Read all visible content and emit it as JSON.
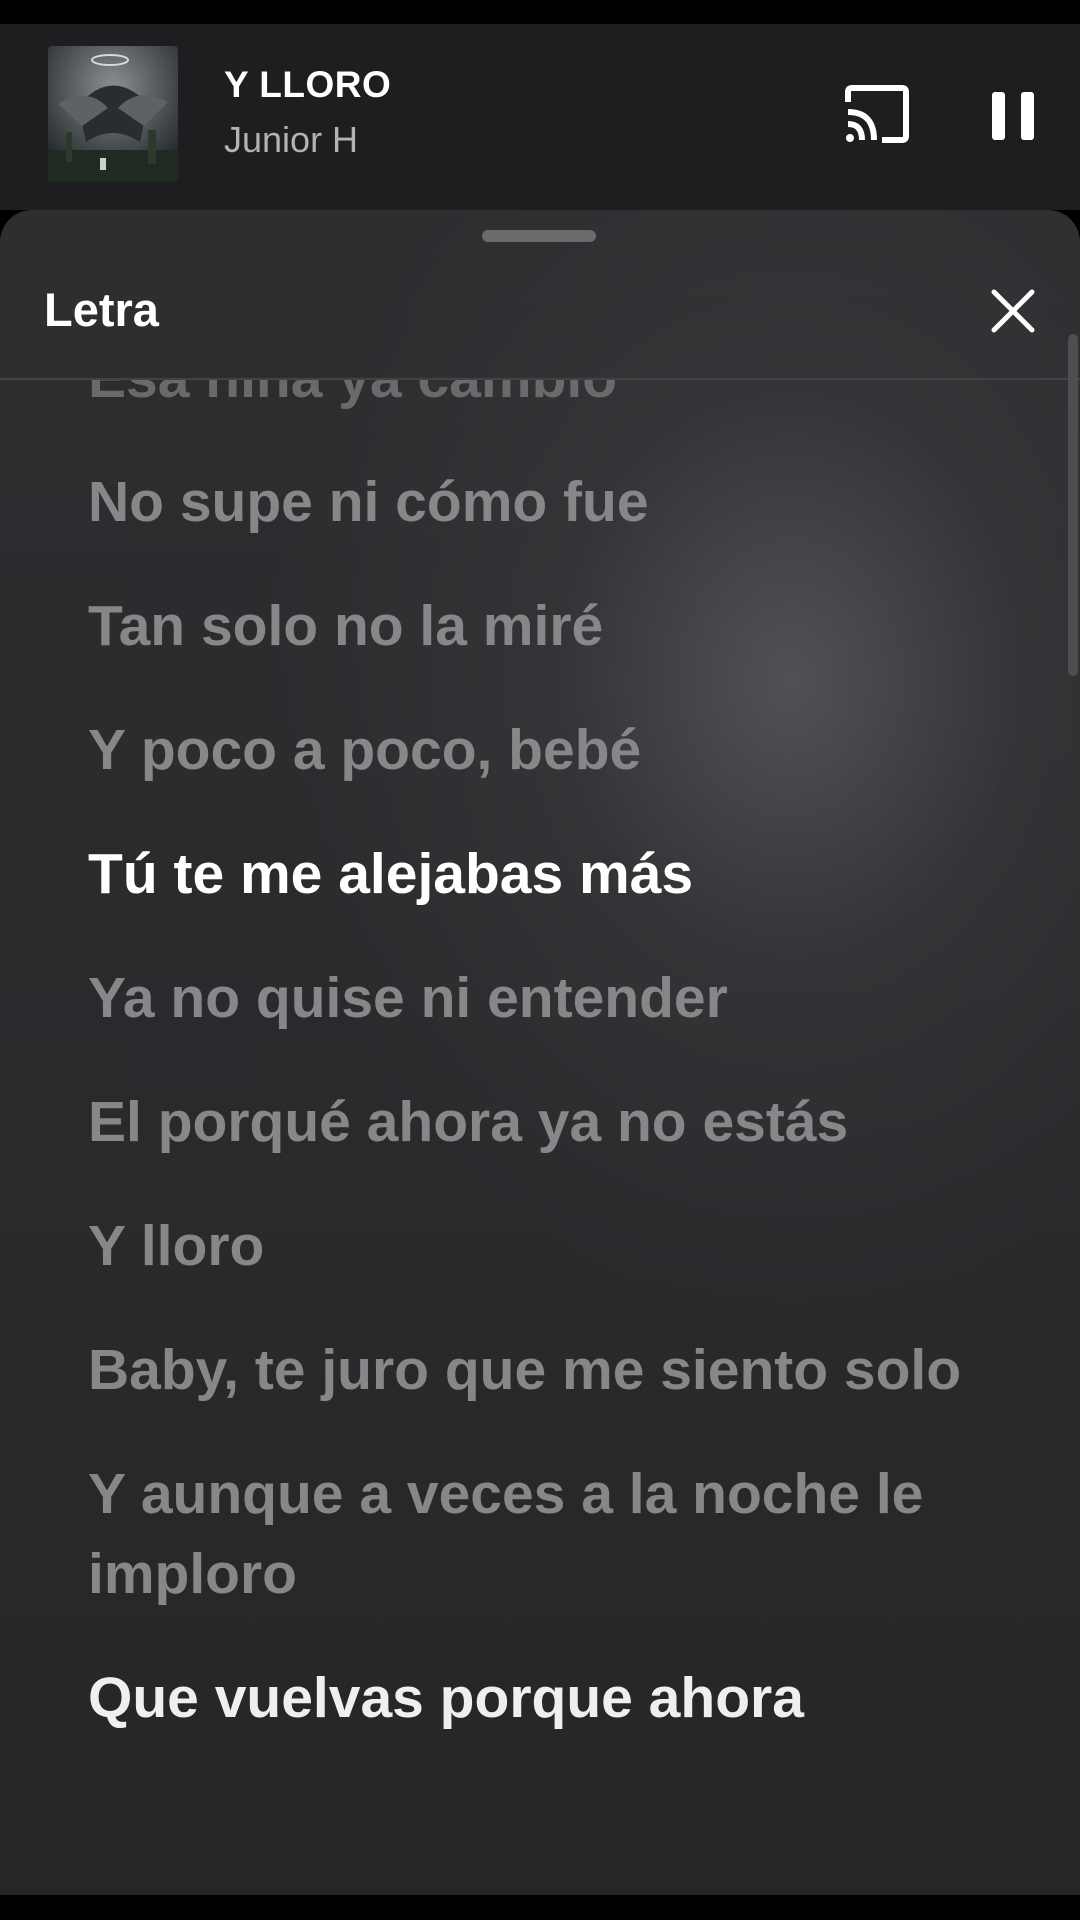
{
  "player": {
    "title": "Y LLORO",
    "artist": "Junior H"
  },
  "sheet": {
    "title": "Letra"
  },
  "lyrics": [
    {
      "text": "Esa niña ya cambió",
      "state": "faded"
    },
    {
      "text": "No supe ni cómo fue",
      "state": "past"
    },
    {
      "text": "Tan solo no la miré",
      "state": "past"
    },
    {
      "text": "Y poco a poco, bebé",
      "state": "past"
    },
    {
      "text": "Tú te me alejabas más",
      "state": "active"
    },
    {
      "text": "Ya no quise ni entender",
      "state": "past"
    },
    {
      "text": "El porqué ahora ya no estás",
      "state": "past"
    },
    {
      "text": "Y lloro",
      "state": "past"
    },
    {
      "text": "Baby, te juro que me siento solo",
      "state": "past"
    },
    {
      "text": "Y aunque a veces a la noche le imploro",
      "state": "past"
    },
    {
      "text": "Que vuelvas porque ahora",
      "state": "upcoming"
    }
  ],
  "icons": {
    "album_art": "album-art",
    "cast": "cast-icon",
    "pause": "pause-icon",
    "close": "close-icon"
  },
  "colors": {
    "player_bg": "#1e1d20",
    "sheet_bg": "#2c2c2f",
    "active_lyric": "#ffffff",
    "inactive_lyric": "#87878a",
    "secondary_text": "#b3b3b3"
  }
}
